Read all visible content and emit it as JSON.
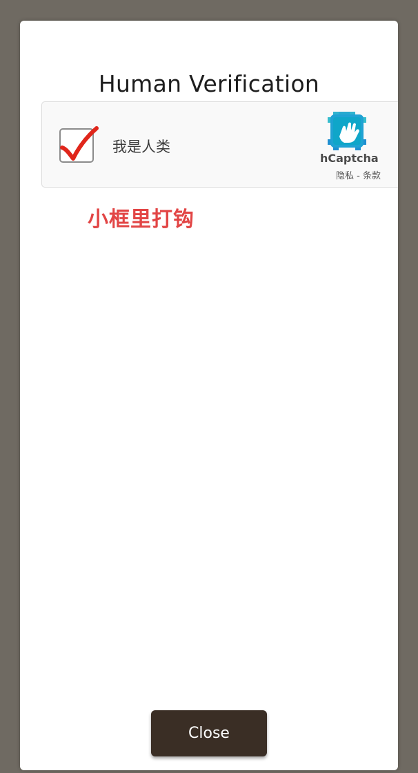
{
  "dialog": {
    "title": "Human Verification",
    "close_label": "Close"
  },
  "captcha": {
    "checkbox_checked": true,
    "label": "我是人类",
    "brand": "hCaptcha",
    "privacy_link": "隐私",
    "separator": " - ",
    "terms_link": "条款",
    "logo_icon": "hcaptcha-hand-icon",
    "check_icon": "red-checkmark-icon"
  },
  "annotation": {
    "text": "小框里打钩",
    "color": "#e24545"
  },
  "colors": {
    "backdrop": "#6f6a62",
    "button": "#3a2e25",
    "hcaptcha_blue": "#1aa3d1"
  }
}
